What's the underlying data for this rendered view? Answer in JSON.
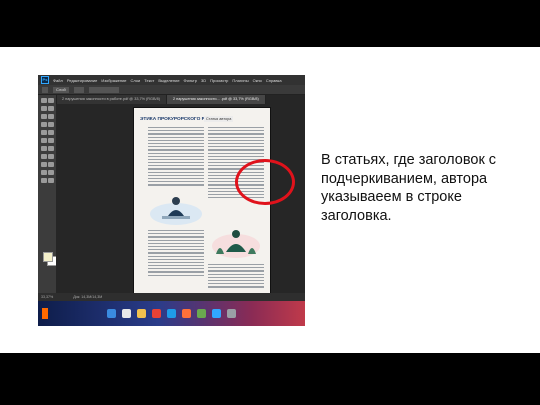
{
  "caption": "В статьях, где заголовок с подчеркиванием, автора указываеем в строке заголовка.",
  "photoshop": {
    "logo": "Ps",
    "menu": [
      "Файл",
      "Редактирование",
      "Изображение",
      "Слои",
      "Текст",
      "Выделение",
      "Фильтр",
      "3D",
      "Просмотр",
      "Плагины",
      "Окно",
      "Справка"
    ],
    "options_value": "Слой",
    "tabs": [
      "2 нарушения законности в работе.pdf @ 33,7% (RGB/8)",
      "2 нарушения законности...  .pdf @ 33,7% (RGB/8)"
    ],
    "status_zoom": "33,37%",
    "status_doc": "Док: 14,3M/14,3M",
    "document": {
      "title": "ЭТИКА ПРОКУРОРСКОГО РАБОТНИКА",
      "author_line": "Статья автора"
    }
  },
  "taskbar": {
    "icons": [
      "windows-icon",
      "search-icon",
      "folder-icon",
      "chrome-icon",
      "edge-icon",
      "firefox-icon",
      "app-icon",
      "photoshop-icon",
      "settings-icon"
    ],
    "icon_colors": [
      "#3a8be0",
      "#e8e8e8",
      "#f2c14e",
      "#e94235",
      "#1f9ce8",
      "#ff7139",
      "#6aa84f",
      "#31a8ff",
      "#9aa0a6"
    ]
  },
  "colors": {
    "highlight_circle": "#e0121b",
    "doc_title": "#1b3a6b"
  }
}
